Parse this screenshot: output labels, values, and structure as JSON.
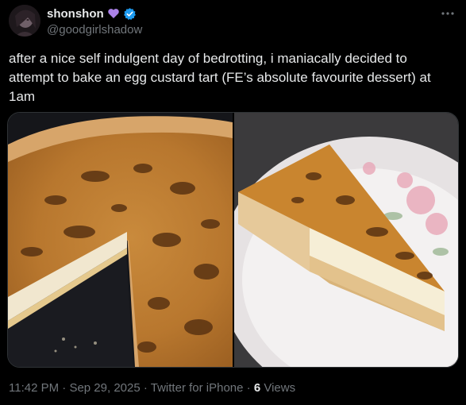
{
  "author": {
    "display_name": "shonshon",
    "handle": "@goodgirlshadow",
    "badge_icons": [
      "purple-heart-icon",
      "verified-badge-icon"
    ]
  },
  "tweet": {
    "text": "after a nice self indulgent day of bedrotting, i maniacally decided to attempt to bake an egg custard tart (FE’s absolute favourite dessert) at 1am"
  },
  "media": {
    "images": [
      "custard-tart-whole-photo",
      "custard-tart-slice-photo"
    ]
  },
  "meta": {
    "time": "11:42 PM",
    "date": "Sep 29, 2025",
    "client": "Twitter for iPhone",
    "separator": "·",
    "views_count": "6",
    "views_label": "Views"
  },
  "colors": {
    "background": "#000000",
    "text": "#e7e9ea",
    "secondary": "#71767b",
    "verified": "#1d9bf0",
    "heart": "#ab82e8"
  }
}
